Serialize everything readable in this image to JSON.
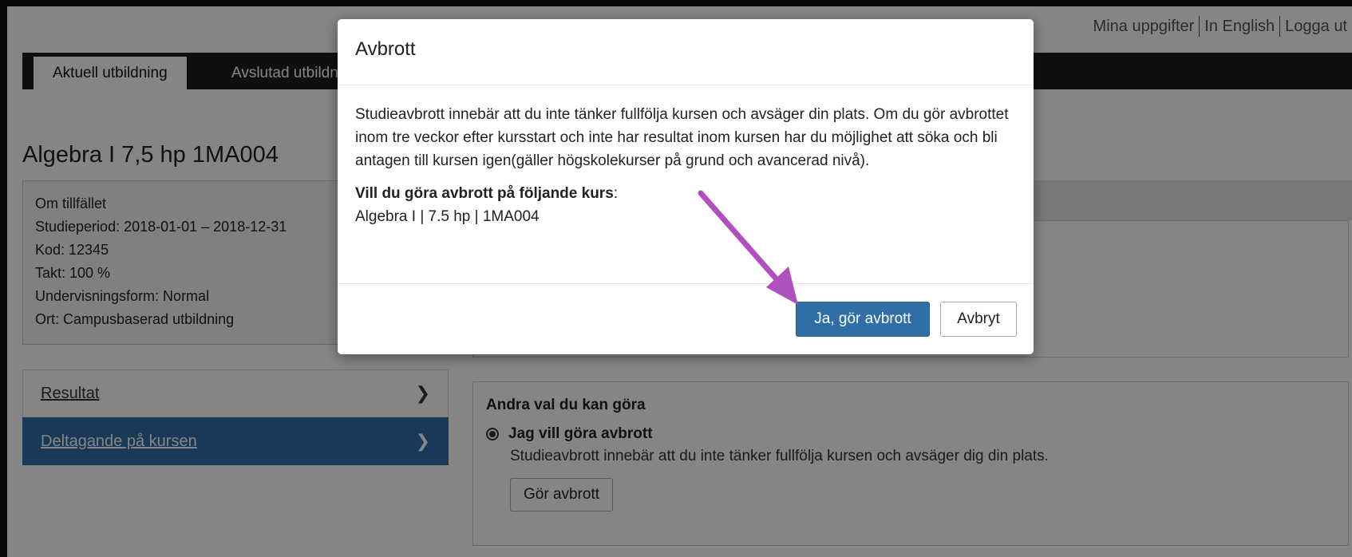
{
  "top_links": [
    "Mina uppgifter",
    "In English",
    "Logga ut"
  ],
  "nav": {
    "active_tab": "Aktuell utbildning",
    "tab2": "Avslutad utbildning"
  },
  "course": {
    "title": "Algebra I 7,5 hp 1MA004",
    "info_heading": "Om tillfället",
    "info_lines": [
      "Studieperiod:  2018-01-01 – 2018-12-31",
      "Kod:  12345",
      "Takt:  100 %",
      "Undervisningsform:  Normal",
      "Ort:  Campusbaserad utbildning"
    ]
  },
  "menu": [
    {
      "label": "Resultat",
      "active": false
    },
    {
      "label": "Deltagande på kursen",
      "active": true
    }
  ],
  "choices": {
    "heading": "Andra val du kan göra",
    "option_label": "Jag vill göra avbrott",
    "option_desc": "Studieavbrott innebär att du inte tänker fullfölja kursen och avsäger dig din plats.",
    "button": "Gör avbrott"
  },
  "modal": {
    "title": "Avbrott",
    "body_text": "Studieavbrott innebär att du inte tänker fullfölja kursen och avsäger din plats. Om du gör avbrottet inom tre veckor efter kursstart och inte har resultat inom kursen har du möjlighet att söka och bli antagen till kursen igen(gäller högskolekurser på grund och avancerad nivå).",
    "question": "Vill du göra avbrott på följande kurs",
    "question_colon": ":",
    "course_line": "Algebra I | 7.5 hp | 1MA004",
    "confirm_button": "Ja, gör avbrott",
    "cancel_button": "Avbryt"
  },
  "colors": {
    "primary": "#2f6ea7",
    "arrow": "#b04fbf"
  },
  "icons": {
    "menu_chevron": "chevron-right-icon",
    "annotation_arrow": "arrow-icon"
  }
}
